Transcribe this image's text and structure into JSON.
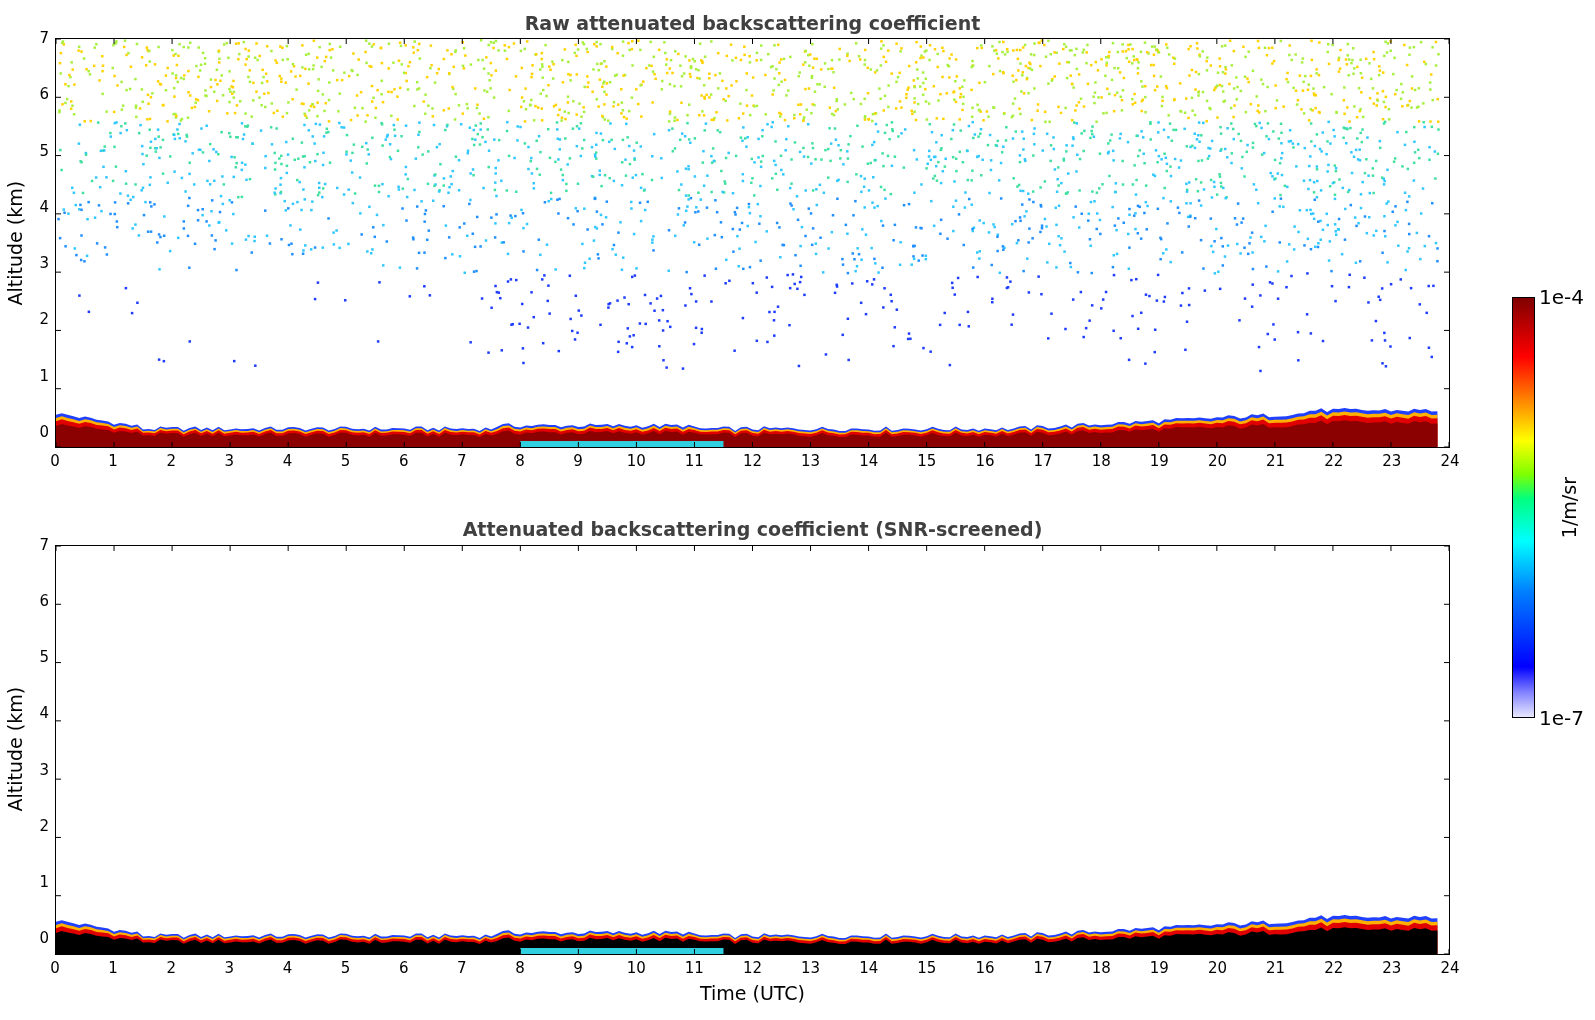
{
  "panels": [
    {
      "kind": "raw",
      "title": "Raw attenuated backscattering coefficient",
      "ylabel": "Altitude (km)",
      "yticks": [
        "7",
        "6",
        "5",
        "4",
        "3",
        "2",
        "1",
        "0"
      ],
      "xticks": [
        "0",
        "1",
        "2",
        "3",
        "4",
        "5",
        "6",
        "7",
        "8",
        "9",
        "10",
        "11",
        "12",
        "13",
        "14",
        "15",
        "16",
        "17",
        "18",
        "19",
        "20",
        "21",
        "22",
        "23",
        "24"
      ]
    },
    {
      "kind": "screened",
      "title": "Attenuated backscattering coefficient (SNR-screened)",
      "ylabel": "Altitude (km)",
      "yticks": [
        "7",
        "6",
        "5",
        "4",
        "3",
        "2",
        "1",
        "0"
      ],
      "xticks": [
        "0",
        "1",
        "2",
        "3",
        "4",
        "5",
        "6",
        "7",
        "8",
        "9",
        "10",
        "11",
        "12",
        "13",
        "14",
        "15",
        "16",
        "17",
        "18",
        "19",
        "20",
        "21",
        "22",
        "23",
        "24"
      ]
    }
  ],
  "xlabel": "Time (UTC)",
  "colorbar": {
    "max_label": "1e-4",
    "min_label": "1e-7",
    "label": "1/m/sr"
  }
}
